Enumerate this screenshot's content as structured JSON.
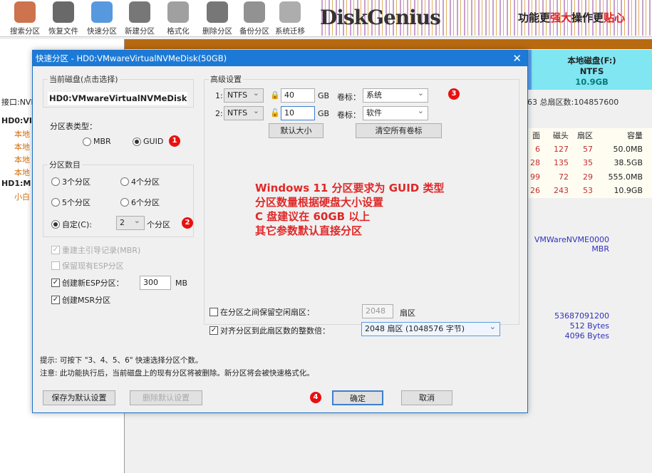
{
  "toolbar": {
    "items": [
      {
        "label": "搜索分区",
        "icon": "search-icon",
        "color": "#c05020"
      },
      {
        "label": "恢复文件",
        "icon": "restore-icon",
        "color": "#444"
      },
      {
        "label": "快速分区",
        "icon": "quick-partition-icon",
        "color": "#2c7fd6"
      },
      {
        "label": "新建分区",
        "icon": "new-partition-icon",
        "color": "#555"
      },
      {
        "label": "格式化",
        "icon": "format-icon",
        "color": "#888"
      },
      {
        "label": "删除分区",
        "icon": "delete-icon",
        "color": "#555"
      },
      {
        "label": "备份分区",
        "icon": "backup-icon",
        "color": "#777"
      },
      {
        "label": "系统迁移",
        "icon": "migrate-icon",
        "color": "#999"
      }
    ]
  },
  "banner": {
    "logo": "DiskGenius",
    "slogan_a": "功能更",
    "slogan_b": "强大",
    "slogan_c": "操作更",
    "slogan_d": "贴心"
  },
  "left_tree": {
    "iface": "接口:NVM",
    "disk0": "HD0:VI",
    "parts": [
      "本地",
      "本地",
      "本地",
      "本地"
    ],
    "disk1": "HD1:M",
    "part1": "小白"
  },
  "disk_map": {
    "name": "本地磁盘(F:)",
    "fs": "NTFS",
    "size": "10.9GB",
    "info": "63  总扇区数:104857600"
  },
  "table": {
    "headers": [
      "面",
      "磁头",
      "扇区",
      "容量"
    ],
    "rows": [
      [
        "6",
        "127",
        "57",
        "50.0MB"
      ],
      [
        "28",
        "135",
        "35",
        "38.5GB"
      ],
      [
        "99",
        "72",
        "29",
        "555.0MB"
      ],
      [
        "26",
        "243",
        "53",
        "10.9GB"
      ]
    ]
  },
  "disk_info": {
    "model": "VMWareNVME0000",
    "type": "MBR",
    "bytes": "53687091200",
    "sector": "512 Bytes",
    "phys": "4096 Bytes"
  },
  "dialog": {
    "title": "快速分区 - HD0:VMwareVirtualNVMeDisk(50GB)",
    "current_disk_label": "当前磁盘(点击选择)",
    "current_disk": "HD0:VMwareVirtualNVMeDisk",
    "table_type_label": "分区表类型：",
    "mbr": "MBR",
    "guid": "GUID",
    "count_label": "分区数目",
    "c3": "3个分区",
    "c4": "4个分区",
    "c5": "5个分区",
    "c6": "6个分区",
    "custom": "自定(C):",
    "custom_value": "2",
    "custom_unit": "个分区",
    "rebuild_mbr": "重建主引导记录(MBR)",
    "keep_esp": "保留现有ESP分区",
    "create_esp": "创建新ESP分区：",
    "esp_size": "300",
    "esp_unit": "MB",
    "create_msr": "创建MSR分区",
    "adv_label": "高级设置",
    "rows": [
      {
        "idx": "1:",
        "fs": "NTFS",
        "size": "40",
        "unit": "GB",
        "vol_label": "卷标：",
        "vol": "系统"
      },
      {
        "idx": "2:",
        "fs": "NTFS",
        "size": "10",
        "unit": "GB",
        "vol_label": "卷标：",
        "vol": "软件"
      }
    ],
    "default_size": "默认大小",
    "clear_labels": "清空所有卷标",
    "note": [
      "Windows 11 分区要求为 GUID 类型",
      "分区数量根据硬盘大小设置",
      "C 盘建议在 60GB 以上",
      "其它参数默认直接分区"
    ],
    "reserve_label": "在分区之间保留空闲扇区：",
    "reserve_value": "2048",
    "reserve_unit": "扇区",
    "align_label": "对齐分区到此扇区数的整数倍：",
    "align_value": "2048 扇区 (1048576 字节)",
    "tip1": "提示: 可按下 \"3、4、5、6\" 快速选择分区个数。",
    "tip2": "注意: 此功能执行后，当前磁盘上的现有分区将被删除。新分区将会被快速格式化。",
    "save_default": "保存为默认设置",
    "delete_default": "删除默认设置",
    "ok": "确定",
    "cancel": "取消",
    "badges": [
      "1",
      "2",
      "3",
      "4"
    ]
  }
}
